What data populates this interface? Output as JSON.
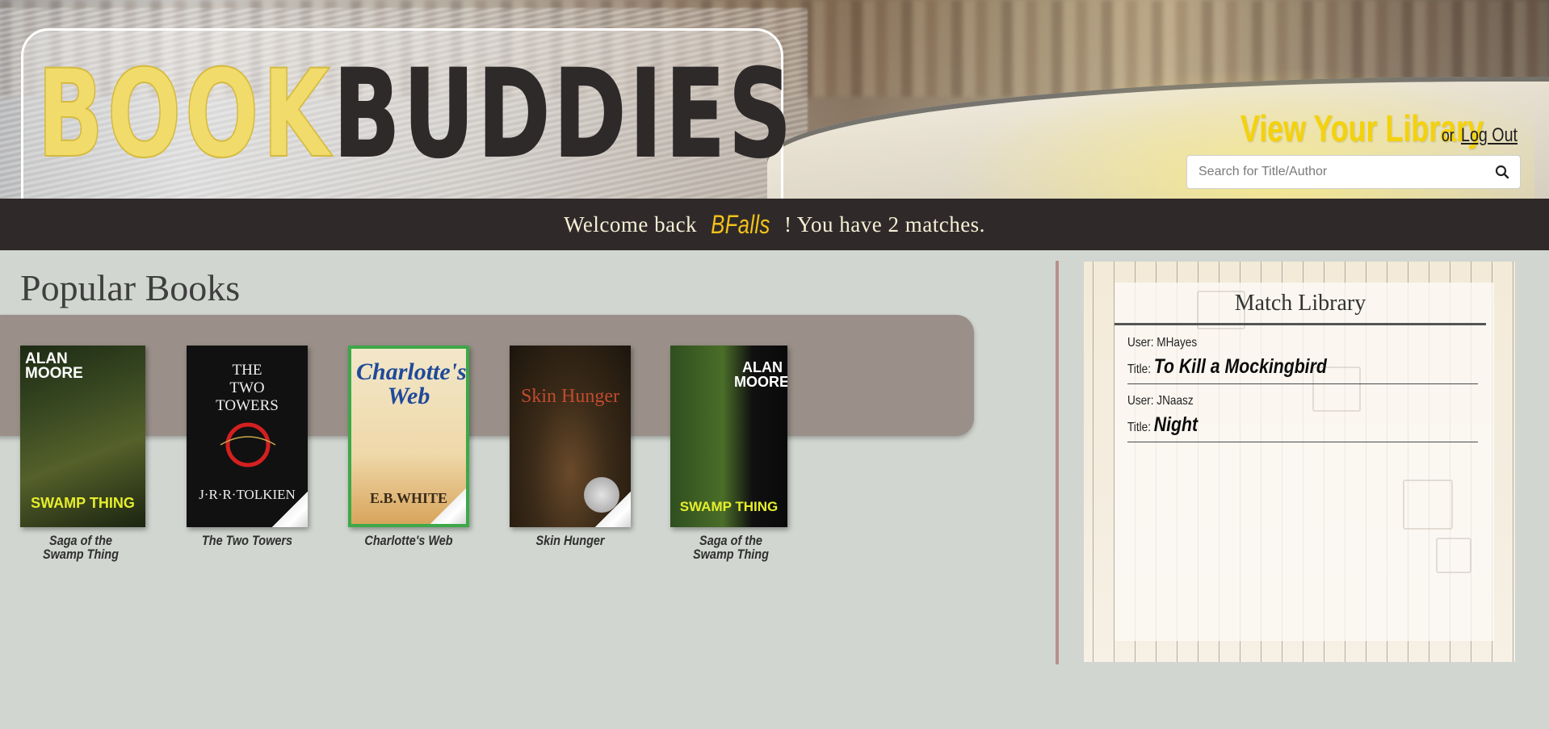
{
  "header": {
    "logo": {
      "part1": "BOOK",
      "part2": "BUDDIES"
    },
    "view_library_label": "View Your Library",
    "or_label": "or",
    "logout_label": "Log Out",
    "search": {
      "placeholder": "Search for Title/Author",
      "button_icon": "search-icon"
    }
  },
  "welcome": {
    "prefix": "Welcome back",
    "username": "BFalls",
    "suffix": "! You have 2 matches."
  },
  "popular": {
    "title": "Popular Books",
    "books": [
      {
        "caption_line1": "Saga of the",
        "caption_line2": "Swamp Thing",
        "cover_author": "ALAN MOORE",
        "cover_title": "SWAMP THING"
      },
      {
        "caption_line1": "The Two Towers",
        "caption_line2": "",
        "cover_author": "J·R·R·TOLKIEN",
        "cover_title": "THE TWO TOWERS"
      },
      {
        "caption_line1": "Charlotte's Web",
        "caption_line2": "",
        "cover_author": "E.B.WHITE",
        "cover_title": "Charlotte's Web"
      },
      {
        "caption_line1": "Skin Hunger",
        "caption_line2": "",
        "cover_author": "",
        "cover_title": "Skin Hunger"
      },
      {
        "caption_line1": "Saga of the",
        "caption_line2": "Swamp Thing",
        "cover_author": "ALAN MOORE",
        "cover_title": "SWAMP THING"
      }
    ]
  },
  "match_library": {
    "title": "Match Library",
    "user_label": "User:",
    "title_label": "Title:",
    "entries": [
      {
        "user": "MHayes",
        "book": "To Kill a Mockingbird"
      },
      {
        "user": "JNaasz",
        "book": "Night"
      }
    ]
  },
  "colors": {
    "accent_yellow": "#f4d20b",
    "welcome_bar": "#2f2a29",
    "page_bg": "#d1d6d0",
    "tray": "#9a9089"
  }
}
